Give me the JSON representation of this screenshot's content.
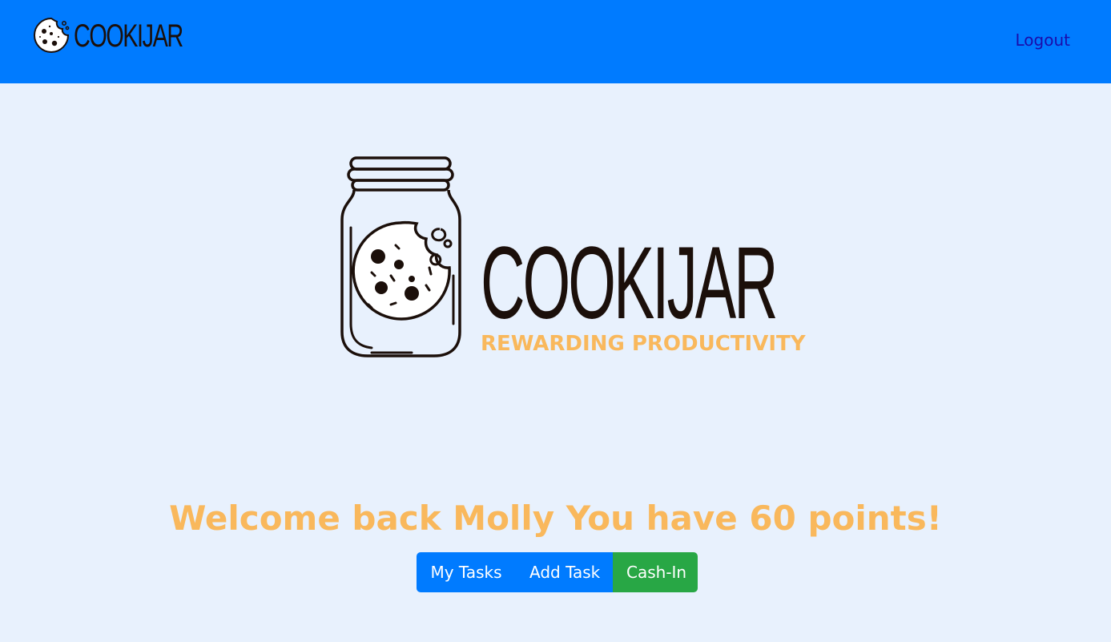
{
  "navbar": {
    "brand_text": "COOKIJAR",
    "logout_label": "Logout",
    "colors": {
      "background": "#007bff",
      "link": "#1a0dab"
    }
  },
  "hero": {
    "title": "COOKIJAR",
    "tagline": "REWARDING PRODUCTIVITY",
    "colors": {
      "title": "#1b0f0a",
      "tagline": "#f9b85c"
    }
  },
  "welcome": {
    "message": "Welcome back Molly You have 60 points!"
  },
  "actions": {
    "my_tasks_label": "My Tasks",
    "add_task_label": "Add Task",
    "cash_in_label": "Cash-In",
    "colors": {
      "primary": "#007bff",
      "success": "#28a745"
    }
  },
  "page": {
    "background": "#e8f1fd"
  }
}
